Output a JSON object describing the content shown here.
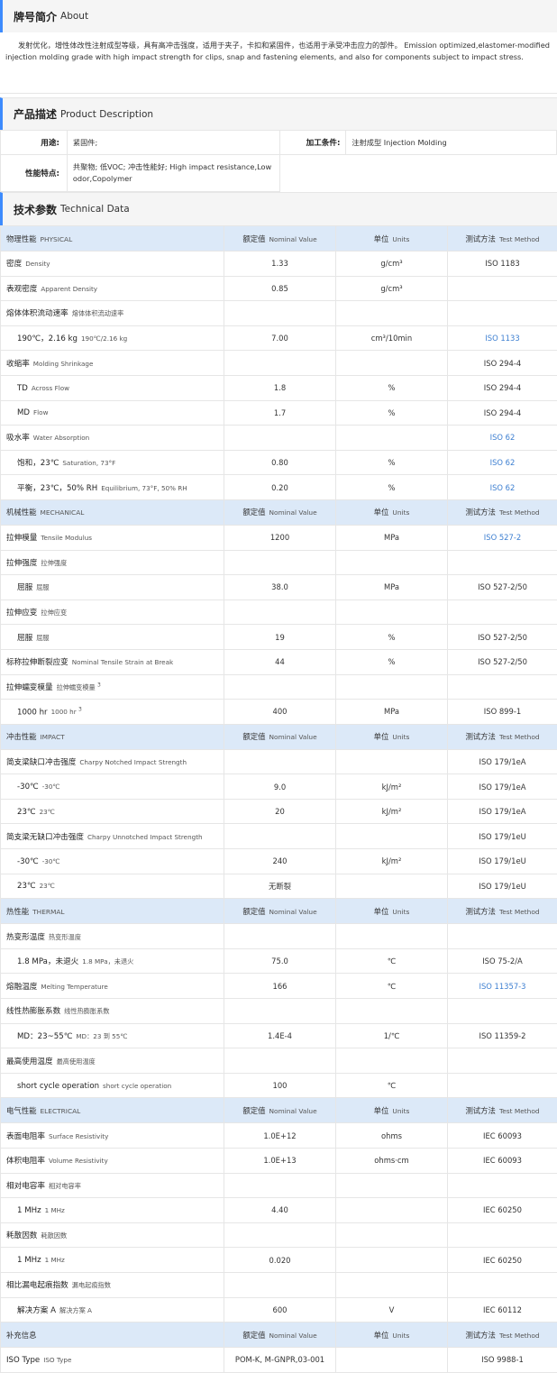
{
  "about": {
    "title_cn": "牌号简介",
    "title_en": "About",
    "text": "发射优化，增性体改性注射成型等级，具有高冲击强度，适用于夹子，卡扣和紧固件，也适用于承受冲击应力的部件。 Emission optimized,elastomer-modified injection molding grade with high impact strength for clips, snap and fastening elements, and also for components subject to impact stress."
  },
  "description": {
    "title_cn": "产品描述",
    "title_en": "Product Description",
    "usage_label": "用途:",
    "usage_value": "紧固件;",
    "processing_label": "加工条件:",
    "processing_value": "注射成型  Injection Molding",
    "features_label": "性能特点:",
    "features_value": "共聚物; 低VOC; 冲击性能好;  High impact resistance,Low odor,Copolymer"
  },
  "tech": {
    "title_cn": "技术参数",
    "title_en": "Technical Data",
    "header": {
      "value_cn": "额定值",
      "value_en": "Nominal Value",
      "unit_cn": "单位",
      "unit_en": "Units",
      "method_cn": "测试方法",
      "method_en": "Test Method"
    },
    "sections": [
      {
        "cn": "物理性能",
        "en": "PHYSICAL",
        "rows": [
          {
            "cn": "密度",
            "en": "Density",
            "value": "1.33",
            "unit": "g/cm³",
            "method": "ISO 1183",
            "link": false,
            "sub": false
          },
          {
            "cn": "表观密度",
            "en": "Apparent Density",
            "value": "0.85",
            "unit": "g/cm³",
            "method": "",
            "link": false,
            "sub": false
          },
          {
            "cn": "熔体体积流动速率",
            "en": "熔体体积流动速率",
            "value": "",
            "unit": "",
            "method": "",
            "link": false,
            "sub": false
          },
          {
            "cn": "190℃，2.16 kg",
            "en": "190℃/2.16 kg",
            "value": "7.00",
            "unit": "cm³/10min",
            "method": "ISO 1133",
            "link": true,
            "sub": true
          },
          {
            "cn": "收缩率",
            "en": "Molding Shrinkage",
            "value": "",
            "unit": "",
            "method": "ISO 294-4",
            "link": false,
            "sub": false
          },
          {
            "cn": "TD",
            "en": "Across Flow",
            "value": "1.8",
            "unit": "%",
            "method": "ISO 294-4",
            "link": false,
            "sub": true
          },
          {
            "cn": "MD",
            "en": "Flow",
            "value": "1.7",
            "unit": "%",
            "method": "ISO 294-4",
            "link": false,
            "sub": true
          },
          {
            "cn": "吸水率",
            "en": "Water Absorption",
            "value": "",
            "unit": "",
            "method": "ISO 62",
            "link": true,
            "sub": false
          },
          {
            "cn": "饱和，23℃",
            "en": "Saturation, 73°F",
            "value": "0.80",
            "unit": "%",
            "method": "ISO 62",
            "link": true,
            "sub": true
          },
          {
            "cn": "平衡，23℃，50% RH",
            "en": "Equilibrium, 73°F, 50% RH",
            "value": "0.20",
            "unit": "%",
            "method": "ISO 62",
            "link": true,
            "sub": true
          }
        ]
      },
      {
        "cn": "机械性能",
        "en": "MECHANICAL",
        "rows": [
          {
            "cn": "拉伸模量",
            "en": "Tensile Modulus",
            "value": "1200",
            "unit": "MPa",
            "method": "ISO 527-2",
            "link": true,
            "sub": false
          },
          {
            "cn": "拉伸强度",
            "en": "拉伸强度",
            "value": "",
            "unit": "",
            "method": "",
            "link": false,
            "sub": false
          },
          {
            "cn": "屈服",
            "en": "屈服",
            "value": "38.0",
            "unit": "MPa",
            "method": "ISO 527-2/50",
            "link": false,
            "sub": true
          },
          {
            "cn": "拉伸应变",
            "en": "拉伸应变",
            "value": "",
            "unit": "",
            "method": "",
            "link": false,
            "sub": false
          },
          {
            "cn": "屈服",
            "en": "屈服",
            "value": "19",
            "unit": "%",
            "method": "ISO 527-2/50",
            "link": false,
            "sub": true
          },
          {
            "cn": "标称拉伸断裂应变",
            "en": "Nominal Tensile Strain at Break",
            "value": "44",
            "unit": "%",
            "method": "ISO 527-2/50",
            "link": false,
            "sub": false
          },
          {
            "cn": "拉伸蠕变模量",
            "en": "拉伸蠕变模量",
            "sup": "3",
            "value": "",
            "unit": "",
            "method": "",
            "link": false,
            "sub": false
          },
          {
            "cn": "1000 hr",
            "en": "1000 hr",
            "sup": "3",
            "value": "400",
            "unit": "MPa",
            "method": "ISO 899-1",
            "link": false,
            "sub": true
          }
        ]
      },
      {
        "cn": "冲击性能",
        "en": "IMPACT",
        "rows": [
          {
            "cn": "简支梁缺口冲击强度",
            "en": "Charpy Notched Impact Strength",
            "value": "",
            "unit": "",
            "method": "ISO 179/1eA",
            "link": false,
            "sub": false
          },
          {
            "cn": "-30℃",
            "en": "-30℃",
            "value": "9.0",
            "unit": "kJ/m²",
            "method": "ISO 179/1eA",
            "link": false,
            "sub": true
          },
          {
            "cn": "23℃",
            "en": "23℃",
            "value": "20",
            "unit": "kJ/m²",
            "method": "ISO 179/1eA",
            "link": false,
            "sub": true
          },
          {
            "cn": "简支梁无缺口冲击强度",
            "en": "Charpy Unnotched Impact Strength",
            "value": "",
            "unit": "",
            "method": "ISO 179/1eU",
            "link": false,
            "sub": false
          },
          {
            "cn": "-30℃",
            "en": "-30℃",
            "value": "240",
            "unit": "kJ/m²",
            "method": "ISO 179/1eU",
            "link": false,
            "sub": true
          },
          {
            "cn": "23℃",
            "en": "23℃",
            "value": "无断裂",
            "unit": "",
            "method": "ISO 179/1eU",
            "link": false,
            "sub": true
          }
        ]
      },
      {
        "cn": "热性能",
        "en": "THERMAL",
        "rows": [
          {
            "cn": "热变形温度",
            "en": "热变形温度",
            "value": "",
            "unit": "",
            "method": "",
            "link": false,
            "sub": false
          },
          {
            "cn": "1.8 MPa，未退火",
            "en": "1.8 MPa，未退火",
            "value": "75.0",
            "unit": "℃",
            "method": "ISO 75-2/A",
            "link": false,
            "sub": true
          },
          {
            "cn": "熔融温度",
            "en": "Melting Temperature",
            "value": "166",
            "unit": "℃",
            "method": "ISO 11357-3",
            "link": true,
            "sub": false
          },
          {
            "cn": "线性热膨胀系数",
            "en": "线性热膨胀系数",
            "value": "",
            "unit": "",
            "method": "",
            "link": false,
            "sub": false
          },
          {
            "cn": "MD：23~55℃",
            "en": "MD：23 到 55℃",
            "value": "1.4E-4",
            "unit": "1/℃",
            "method": "ISO 11359-2",
            "link": false,
            "sub": true
          },
          {
            "cn": "最高使用温度",
            "en": "最高使用温度",
            "value": "",
            "unit": "",
            "method": "",
            "link": false,
            "sub": false
          },
          {
            "cn": "short cycle operation",
            "en": "short cycle operation",
            "value": "100",
            "unit": "℃",
            "method": "",
            "link": false,
            "sub": true
          }
        ]
      },
      {
        "cn": "电气性能",
        "en": "ELECTRICAL",
        "rows": [
          {
            "cn": "表面电阻率",
            "en": "Surface Resistivity",
            "value": "1.0E+12",
            "unit": "ohms",
            "method": "IEC 60093",
            "link": false,
            "sub": false
          },
          {
            "cn": "体积电阻率",
            "en": "Volume Resistivity",
            "value": "1.0E+13",
            "unit": "ohms·cm",
            "method": "IEC 60093",
            "link": false,
            "sub": false
          },
          {
            "cn": "相对电容率",
            "en": "相对电容率",
            "value": "",
            "unit": "",
            "method": "",
            "link": false,
            "sub": false
          },
          {
            "cn": "1 MHz",
            "en": "1 MHz",
            "value": "4.40",
            "unit": "",
            "method": "IEC 60250",
            "link": false,
            "sub": true
          },
          {
            "cn": "耗散因数",
            "en": "耗散因数",
            "value": "",
            "unit": "",
            "method": "",
            "link": false,
            "sub": false
          },
          {
            "cn": "1 MHz",
            "en": "1 MHz",
            "value": "0.020",
            "unit": "",
            "method": "IEC 60250",
            "link": false,
            "sub": true
          },
          {
            "cn": "相比漏电起痕指数",
            "en": "漏电起痕指数",
            "value": "",
            "unit": "",
            "method": "",
            "link": false,
            "sub": false
          },
          {
            "cn": "解决方案 A",
            "en": "解决方案 A",
            "value": "600",
            "unit": "V",
            "method": "IEC 60112",
            "link": false,
            "sub": true
          }
        ]
      },
      {
        "cn": "补充信息",
        "en": "",
        "rows": [
          {
            "cn": "ISO Type",
            "en": "ISO Type",
            "value": "POM-K, M-GNPR,03-001",
            "unit": "",
            "method": "ISO 9988-1",
            "link": false,
            "sub": false
          }
        ]
      }
    ]
  },
  "colors": {
    "accent": "#3d8bfd",
    "category_bg": "#dce9f8",
    "link": "#3d7fd1"
  }
}
